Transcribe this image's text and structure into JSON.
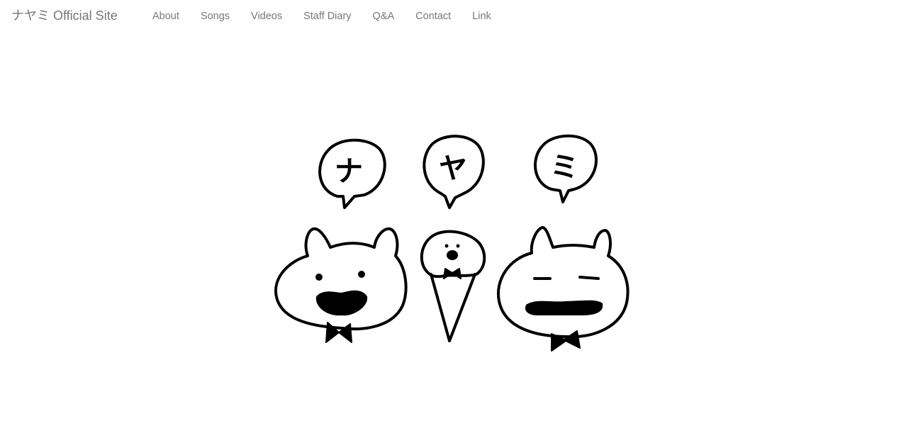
{
  "navbar": {
    "brand": "ナヤミ Official Site",
    "links": [
      {
        "label": "About"
      },
      {
        "label": "Songs"
      },
      {
        "label": "Videos"
      },
      {
        "label": "Staff Diary"
      },
      {
        "label": "Q&A"
      },
      {
        "label": "Contact"
      },
      {
        "label": "Link"
      }
    ]
  },
  "hero": {
    "bubbles": [
      "ナ",
      "ヤ",
      "ミ"
    ],
    "characters": [
      "bear-open-mouth-icon",
      "ice-cream-cone-icon",
      "bear-smiling-icon"
    ],
    "colors": {
      "ink": "#000000",
      "background": "#ffffff",
      "nav_text": "#777777"
    }
  }
}
